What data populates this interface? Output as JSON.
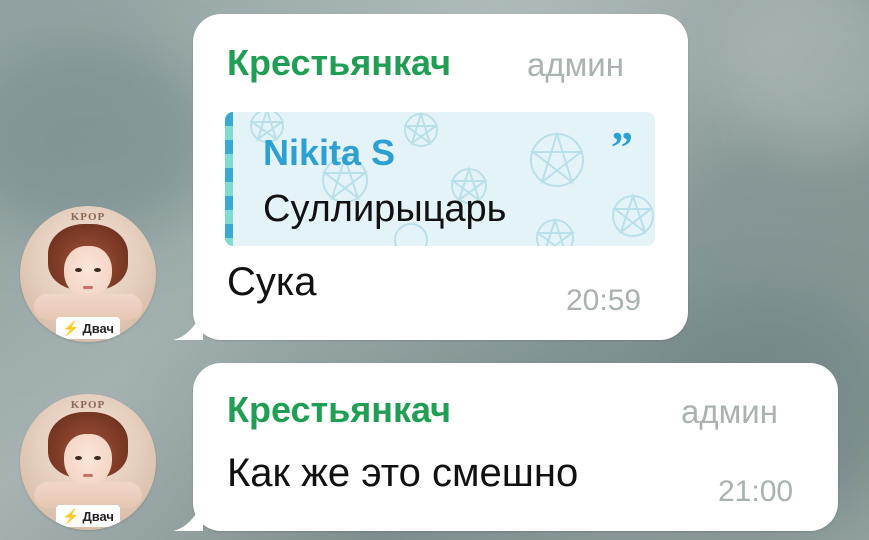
{
  "messages": [
    {
      "sender": "Крестьянкач",
      "role": "админ",
      "reply": {
        "author": "Nikita S",
        "text": "Суллирыцарь"
      },
      "text": "Сука",
      "time": "20:59"
    },
    {
      "sender": "Крестьянкач",
      "role": "админ",
      "text": "Как же это смешно",
      "time": "21:00"
    }
  ],
  "avatar": {
    "top_text": "KPOP",
    "badge_text": "Двач"
  },
  "colors": {
    "sender": "#1f9e54",
    "role": "#a8b2b0",
    "reply_accent": "#2e9fd1",
    "bubble": "#ffffff"
  }
}
